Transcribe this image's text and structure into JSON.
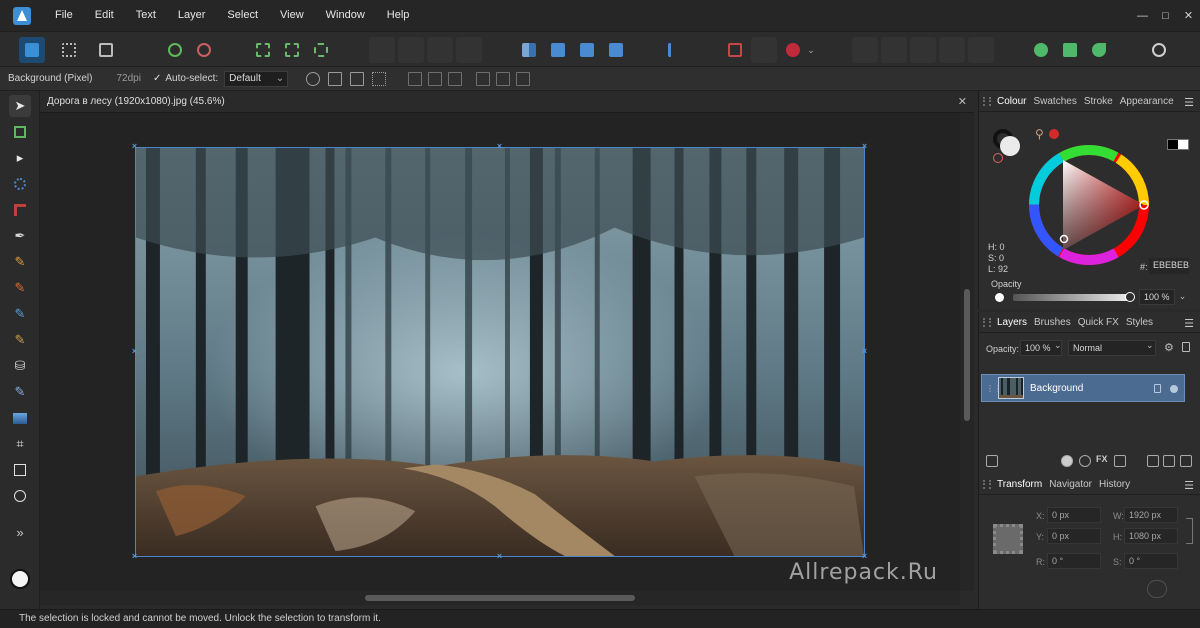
{
  "menu": [
    "File",
    "Edit",
    "Text",
    "Layer",
    "Select",
    "View",
    "Window",
    "Help"
  ],
  "window_controls": {
    "minimize": "—",
    "maximize": "□",
    "close": "✕"
  },
  "context": {
    "layer_type": "Background (Pixel)",
    "dpi": "72dpi",
    "auto_select_label": "Auto-select:",
    "auto_select_value": "Default",
    "auto_select_checked": true
  },
  "document": {
    "tab_title": "Дорога в лесу (1920x1080).jpg (45.6%)",
    "close_symbol": "✕",
    "watermark": "Allrepack.Ru"
  },
  "status": {
    "message": "The selection is locked and cannot be moved. Unlock the selection to transform it."
  },
  "colour_panel": {
    "tabs": [
      "Colour",
      "Swatches",
      "Stroke",
      "Appearance"
    ],
    "h": "H: 0",
    "s": "S: 0",
    "l": "L: 92",
    "hex_label": "#:",
    "hex_value": "EBEBEB",
    "opacity_label": "Opacity",
    "opacity_value": "100 %",
    "accent_red": "#d42a2a"
  },
  "layers_panel": {
    "tabs": [
      "Layers",
      "Brushes",
      "Quick FX",
      "Styles"
    ],
    "opacity_label": "Opacity:",
    "opacity_value": "100 %",
    "blend_mode": "Normal",
    "layers": [
      {
        "name": "Background",
        "selected": true
      }
    ]
  },
  "transform_panel": {
    "tabs": [
      "Transform",
      "Navigator",
      "History"
    ],
    "x_label": "X:",
    "x_value": "0 px",
    "y_label": "Y:",
    "y_value": "0 px",
    "w_label": "W:",
    "w_value": "1920 px",
    "h_label": "H:",
    "h_value": "1080 px",
    "r_label": "R:",
    "r_value": "0 °",
    "s_label": "S:",
    "s_value": "0 °"
  }
}
